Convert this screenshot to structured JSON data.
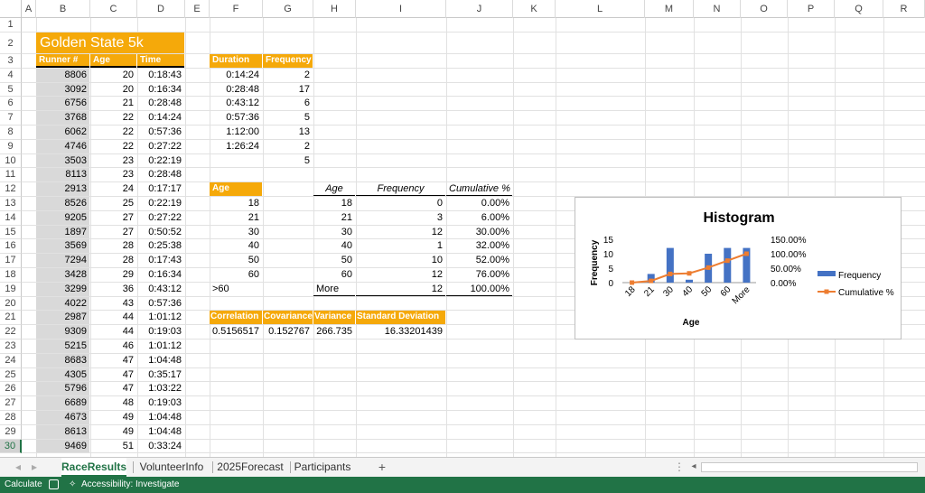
{
  "columns": [
    "A",
    "B",
    "C",
    "D",
    "E",
    "F",
    "G",
    "H",
    "I",
    "J",
    "K",
    "L",
    "M",
    "N",
    "O",
    "P",
    "Q",
    "R"
  ],
  "rows": [
    "1",
    "2",
    "3",
    "4",
    "5",
    "6",
    "7",
    "8",
    "9",
    "10",
    "11",
    "12",
    "13",
    "14",
    "15",
    "16",
    "17",
    "18",
    "19",
    "20",
    "21",
    "22",
    "23",
    "24",
    "25",
    "26",
    "27",
    "28",
    "29",
    "30"
  ],
  "title": "Golden State 5k",
  "race_headers": [
    "Runner #",
    "Age",
    "Time"
  ],
  "race_rows": [
    [
      "8806",
      "20",
      "0:18:43"
    ],
    [
      "3092",
      "20",
      "0:16:34"
    ],
    [
      "6756",
      "21",
      "0:28:48"
    ],
    [
      "3768",
      "22",
      "0:14:24"
    ],
    [
      "6062",
      "22",
      "0:57:36"
    ],
    [
      "4746",
      "22",
      "0:27:22"
    ],
    [
      "3503",
      "23",
      "0:22:19"
    ],
    [
      "8113",
      "23",
      "0:28:48"
    ],
    [
      "2913",
      "24",
      "0:17:17"
    ],
    [
      "8526",
      "25",
      "0:22:19"
    ],
    [
      "9205",
      "27",
      "0:27:22"
    ],
    [
      "1897",
      "27",
      "0:50:52"
    ],
    [
      "3569",
      "28",
      "0:25:38"
    ],
    [
      "7294",
      "28",
      "0:17:43"
    ],
    [
      "3428",
      "29",
      "0:16:34"
    ],
    [
      "3299",
      "36",
      "0:43:12"
    ],
    [
      "4022",
      "43",
      "0:57:36"
    ],
    [
      "2987",
      "44",
      "1:01:12"
    ],
    [
      "9309",
      "44",
      "0:19:03"
    ],
    [
      "5215",
      "46",
      "1:01:12"
    ],
    [
      "8683",
      "47",
      "1:04:48"
    ],
    [
      "4305",
      "47",
      "0:35:17"
    ],
    [
      "5796",
      "47",
      "1:03:22"
    ],
    [
      "6689",
      "48",
      "0:19:03"
    ],
    [
      "4673",
      "49",
      "1:04:48"
    ],
    [
      "8613",
      "49",
      "1:04:48"
    ],
    [
      "9469",
      "51",
      "0:33:24"
    ]
  ],
  "duration_table": {
    "headers": [
      "Duration",
      "Frequency"
    ],
    "rows": [
      [
        "0:14:24",
        "2"
      ],
      [
        "0:28:48",
        "17"
      ],
      [
        "0:43:12",
        "6"
      ],
      [
        "0:57:36",
        "5"
      ],
      [
        "1:12:00",
        "13"
      ],
      [
        "1:26:24",
        "2"
      ],
      [
        "",
        "5"
      ]
    ]
  },
  "age_bins": {
    "header": "Age",
    "values": [
      "18",
      "21",
      "30",
      "40",
      "50",
      "60",
      ">60"
    ]
  },
  "histogram_table": {
    "headers": [
      "Age",
      "Frequency",
      "Cumulative %"
    ],
    "rows": [
      [
        "18",
        "0",
        "0.00%"
      ],
      [
        "21",
        "3",
        "6.00%"
      ],
      [
        "30",
        "12",
        "30.00%"
      ],
      [
        "40",
        "1",
        "32.00%"
      ],
      [
        "50",
        "10",
        "52.00%"
      ],
      [
        "60",
        "12",
        "76.00%"
      ],
      [
        "More",
        "12",
        "100.00%"
      ]
    ]
  },
  "stats_table": {
    "headers": [
      "Correlation",
      "Covariance",
      "Variance",
      "Standard Deviation"
    ],
    "values": [
      "0.5156517",
      "0.152767",
      "266.735",
      "16.33201439"
    ]
  },
  "chart_data": {
    "type": "bar",
    "title": "Histogram",
    "xlabel": "Age",
    "ylabel": "Frequency",
    "categories": [
      "18",
      "21",
      "30",
      "40",
      "50",
      "60",
      "More"
    ],
    "series": [
      {
        "name": "Frequency",
        "type": "bar",
        "values": [
          0,
          3,
          12,
          1,
          10,
          12,
          12
        ],
        "color": "#4472c4"
      },
      {
        "name": "Cumulative %",
        "type": "line",
        "values": [
          0,
          6,
          30,
          32,
          52,
          76,
          100
        ],
        "color": "#ed7d31"
      }
    ],
    "ylim": [
      0,
      15
    ],
    "yticks": [
      "0",
      "5",
      "10",
      "15"
    ],
    "y2lim": [
      0,
      150
    ],
    "y2ticks": [
      "0.00%",
      "50.00%",
      "100.00%",
      "150.00%"
    ],
    "legend": "right"
  },
  "tabs": [
    "RaceResults",
    "VolunteerInfo",
    "2025Forecast",
    "Participants"
  ],
  "active_tab": "RaceResults",
  "add_sheet_label": "+",
  "status": {
    "mode": "Calculate",
    "accessibility": "Accessibility: Investigate"
  },
  "colors": {
    "orange": "#f5a90a",
    "excel_green": "#217346",
    "gray_fill": "#d9d9d9"
  }
}
